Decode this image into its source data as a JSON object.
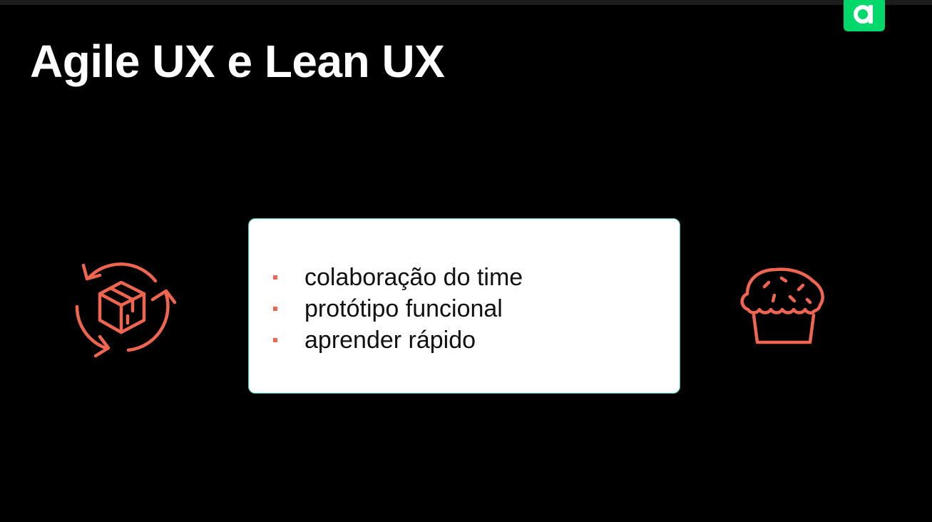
{
  "slide": {
    "title": "Agile UX e Lean UX",
    "bullets": [
      "colaboração do time",
      "protótipo funcional",
      "aprender rápido"
    ]
  },
  "icons": {
    "left": "box-cycle-icon",
    "right": "cupcake-icon",
    "logo": "brand-logo-icon"
  },
  "colors": {
    "background": "#000000",
    "title": "#ffffff",
    "accent_coral": "#f0654f",
    "card_border": "#42c9b4",
    "logo_green": "#00d86b"
  }
}
